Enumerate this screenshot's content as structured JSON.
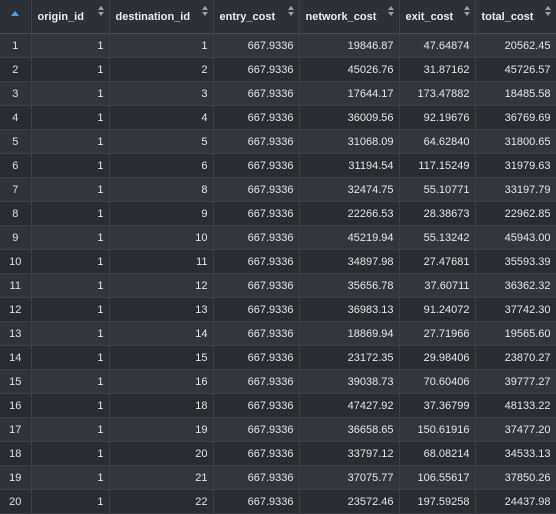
{
  "table": {
    "columns": [
      "origin_id",
      "destination_id",
      "entry_cost",
      "network_cost",
      "exit_cost",
      "total_cost"
    ],
    "rows": [
      {
        "index": "1",
        "origin_id": "1",
        "destination_id": "1",
        "entry_cost": "667.9336",
        "network_cost": "19846.87",
        "exit_cost": "47.64874",
        "total_cost": "20562.45"
      },
      {
        "index": "2",
        "origin_id": "1",
        "destination_id": "2",
        "entry_cost": "667.9336",
        "network_cost": "45026.76",
        "exit_cost": "31.87162",
        "total_cost": "45726.57"
      },
      {
        "index": "3",
        "origin_id": "1",
        "destination_id": "3",
        "entry_cost": "667.9336",
        "network_cost": "17644.17",
        "exit_cost": "173.47882",
        "total_cost": "18485.58"
      },
      {
        "index": "4",
        "origin_id": "1",
        "destination_id": "4",
        "entry_cost": "667.9336",
        "network_cost": "36009.56",
        "exit_cost": "92.19676",
        "total_cost": "36769.69"
      },
      {
        "index": "5",
        "origin_id": "1",
        "destination_id": "5",
        "entry_cost": "667.9336",
        "network_cost": "31068.09",
        "exit_cost": "64.62840",
        "total_cost": "31800.65"
      },
      {
        "index": "6",
        "origin_id": "1",
        "destination_id": "6",
        "entry_cost": "667.9336",
        "network_cost": "31194.54",
        "exit_cost": "117.15249",
        "total_cost": "31979.63"
      },
      {
        "index": "7",
        "origin_id": "1",
        "destination_id": "8",
        "entry_cost": "667.9336",
        "network_cost": "32474.75",
        "exit_cost": "55.10771",
        "total_cost": "33197.79"
      },
      {
        "index": "8",
        "origin_id": "1",
        "destination_id": "9",
        "entry_cost": "667.9336",
        "network_cost": "22266.53",
        "exit_cost": "28.38673",
        "total_cost": "22962.85"
      },
      {
        "index": "9",
        "origin_id": "1",
        "destination_id": "10",
        "entry_cost": "667.9336",
        "network_cost": "45219.94",
        "exit_cost": "55.13242",
        "total_cost": "45943.00"
      },
      {
        "index": "10",
        "origin_id": "1",
        "destination_id": "11",
        "entry_cost": "667.9336",
        "network_cost": "34897.98",
        "exit_cost": "27.47681",
        "total_cost": "35593.39"
      },
      {
        "index": "11",
        "origin_id": "1",
        "destination_id": "12",
        "entry_cost": "667.9336",
        "network_cost": "35656.78",
        "exit_cost": "37.60711",
        "total_cost": "36362.32"
      },
      {
        "index": "12",
        "origin_id": "1",
        "destination_id": "13",
        "entry_cost": "667.9336",
        "network_cost": "36983.13",
        "exit_cost": "91.24072",
        "total_cost": "37742.30"
      },
      {
        "index": "13",
        "origin_id": "1",
        "destination_id": "14",
        "entry_cost": "667.9336",
        "network_cost": "18869.94",
        "exit_cost": "27.71966",
        "total_cost": "19565.60"
      },
      {
        "index": "14",
        "origin_id": "1",
        "destination_id": "15",
        "entry_cost": "667.9336",
        "network_cost": "23172.35",
        "exit_cost": "29.98406",
        "total_cost": "23870.27"
      },
      {
        "index": "15",
        "origin_id": "1",
        "destination_id": "16",
        "entry_cost": "667.9336",
        "network_cost": "39038.73",
        "exit_cost": "70.60406",
        "total_cost": "39777.27"
      },
      {
        "index": "16",
        "origin_id": "1",
        "destination_id": "18",
        "entry_cost": "667.9336",
        "network_cost": "47427.92",
        "exit_cost": "37.36799",
        "total_cost": "48133.22"
      },
      {
        "index": "17",
        "origin_id": "1",
        "destination_id": "19",
        "entry_cost": "667.9336",
        "network_cost": "36658.65",
        "exit_cost": "150.61916",
        "total_cost": "37477.20"
      },
      {
        "index": "18",
        "origin_id": "1",
        "destination_id": "20",
        "entry_cost": "667.9336",
        "network_cost": "33797.12",
        "exit_cost": "68.08214",
        "total_cost": "34533.13"
      },
      {
        "index": "19",
        "origin_id": "1",
        "destination_id": "21",
        "entry_cost": "667.9336",
        "network_cost": "37075.77",
        "exit_cost": "106.55617",
        "total_cost": "37850.26"
      },
      {
        "index": "20",
        "origin_id": "1",
        "destination_id": "22",
        "entry_cost": "667.9336",
        "network_cost": "23572.46",
        "exit_cost": "197.59258",
        "total_cost": "24437.98"
      }
    ]
  },
  "colors": {
    "background": "#282a30",
    "header_background": "#2d3037",
    "row_odd": "#33363d",
    "row_even": "#2a2c32",
    "sort_arrow_active": "#4aa3df",
    "sort_arrow_inactive": "#9aa0a8"
  },
  "icons": {
    "index_sort": "sort-ascending-icon",
    "column_sort": "sort-toggle-icon"
  }
}
